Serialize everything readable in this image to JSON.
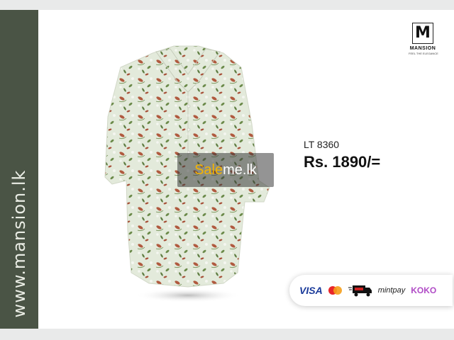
{
  "sidebar": {
    "website": "www.mansion.lk",
    "color": "#4a5445"
  },
  "logo": {
    "letter": "M",
    "brand": "MANSION",
    "tagline": "FEEL THE ELEGANCE"
  },
  "product": {
    "code": "LT 8360",
    "price": "Rs. 1890/=",
    "image": "floral-blouse"
  },
  "watermark": {
    "part1": "Sale",
    "part2": "me.lk"
  },
  "payments": {
    "visa": "VISA",
    "mastercard": "mastercard-icon",
    "delivery": "cash-on-delivery-icon",
    "mintpay": "mintpay",
    "koko": "KOKO"
  }
}
